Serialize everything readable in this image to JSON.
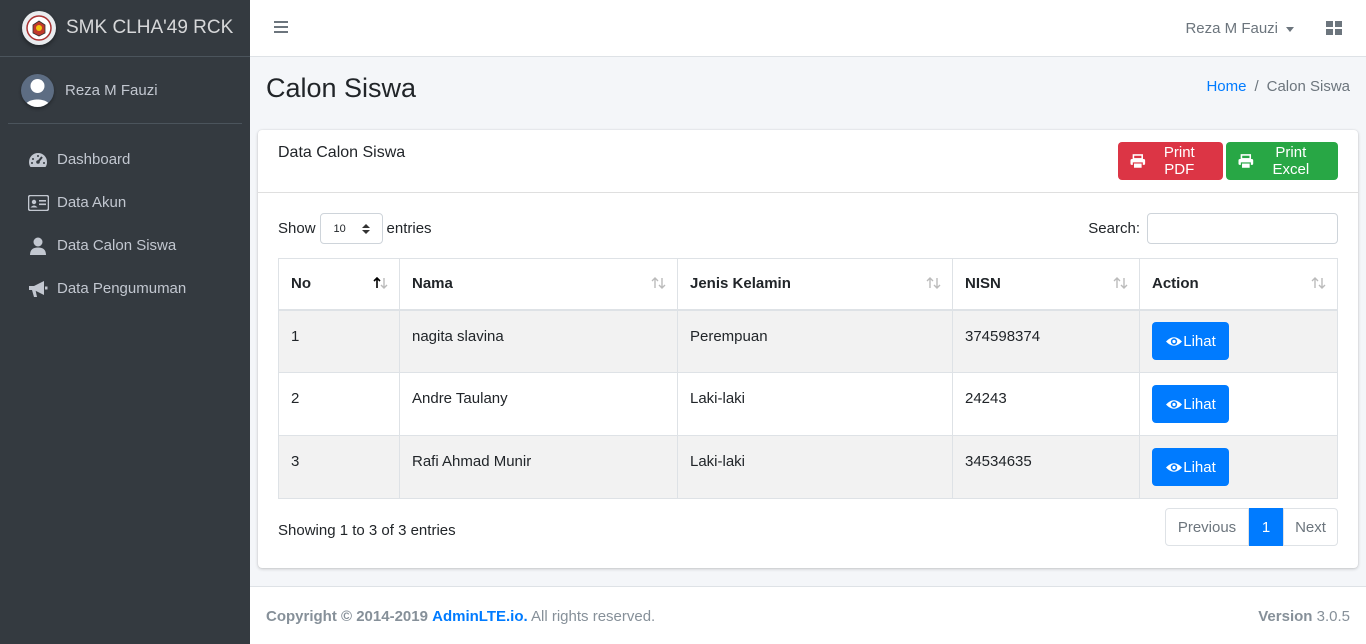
{
  "brand": {
    "title": "SMK CLHA'49 RCK"
  },
  "sidebar": {
    "user_name": "Reza M Fauzi",
    "items": [
      {
        "label": "Dashboard",
        "icon": "tachometer-icon"
      },
      {
        "label": "Data Akun",
        "icon": "id-card-icon"
      },
      {
        "label": "Data Calon Siswa",
        "icon": "user-icon"
      },
      {
        "label": "Data Pengumuman",
        "icon": "bullhorn-icon"
      }
    ]
  },
  "header": {
    "user_menu": "Reza M Fauzi"
  },
  "page": {
    "title": "Calon Siswa",
    "breadcrumb": {
      "home": "Home",
      "sep": "/",
      "current": "Calon Siswa"
    }
  },
  "card": {
    "title": "Data Calon Siswa",
    "print_pdf": "Print PDF",
    "print_excel": "Print Excel",
    "show_label": "Show",
    "entries_value": "10",
    "entries_label": "entries",
    "search_label": "Search:",
    "search_value": ""
  },
  "table": {
    "columns": [
      "No",
      "Nama",
      "Jenis Kelamin",
      "NISN",
      "Action"
    ],
    "rows": [
      {
        "no": "1",
        "nama": "nagita slavina",
        "jk": "Perempuan",
        "nisn": "374598374",
        "action": "Lihat"
      },
      {
        "no": "2",
        "nama": "Andre Taulany",
        "jk": "Laki-laki",
        "nisn": "24243",
        "action": "Lihat"
      },
      {
        "no": "3",
        "nama": "Rafi Ahmad Munir",
        "jk": "Laki-laki",
        "nisn": "34534635",
        "action": "Lihat"
      }
    ],
    "info": "Showing 1 to 3 of 3 entries",
    "pagination": {
      "prev": "Previous",
      "page": "1",
      "next": "Next"
    }
  },
  "footer": {
    "copyright": "Copyright © 2014-2019",
    "link": "AdminLTE.io.",
    "rights": "All rights reserved.",
    "version_label": "Version",
    "version": "3.0.5"
  },
  "colors": {
    "primary": "#007bff",
    "danger": "#dc3545",
    "success": "#28a745",
    "sidebar": "#343a40"
  }
}
